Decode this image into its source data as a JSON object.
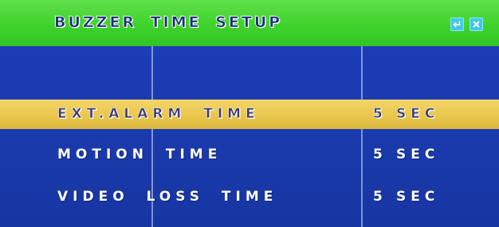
{
  "header": {
    "title": "BUZZER TIME SETUP",
    "buttons": [
      {
        "icon": "enter-icon"
      },
      {
        "icon": "exit-icon"
      }
    ]
  },
  "rows": [
    {
      "label": "EXT.ALARM TIME",
      "value": "5",
      "unit": "SEC",
      "selected": true
    },
    {
      "label": "MOTION TIME",
      "value": "5",
      "unit": "SEC",
      "selected": false
    },
    {
      "label": "VIDEO LOSS TIME",
      "value": "5",
      "unit": "SEC",
      "selected": false
    }
  ],
  "colors": {
    "title_bar": "#3fd32c",
    "background": "#1c3fbd",
    "selected_row": "#e9c64b",
    "button": "#3ec9e6"
  }
}
